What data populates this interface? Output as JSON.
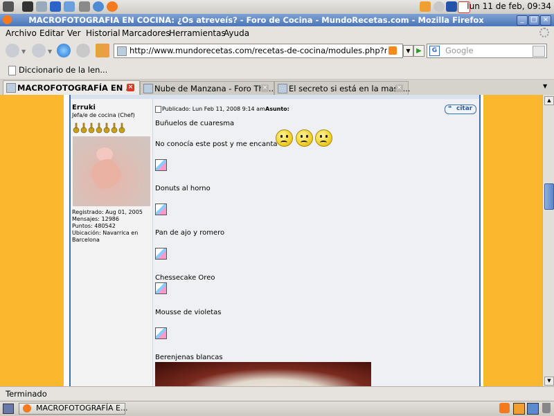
{
  "top_panel": {
    "clock": "lun 11 de feb, 09:34"
  },
  "window": {
    "title": "MACROFOTOGRAFIA EN COCINA: ¿Os atreveís? - Foro de Cocina - MundoRecetas.com - Mozilla Firefox"
  },
  "menu": {
    "archivo": "Archivo",
    "editar": "Editar",
    "ver": "Ver",
    "historial": "Historial",
    "marcadores": "Marcadores",
    "herramientas": "Herramientas",
    "ayuda": "Ayuda"
  },
  "navbar": {
    "url": "http://www.mundorecetas.com/recetas-de-cocina/modules.php?name=Foro",
    "search_placeholder": "Google"
  },
  "bookmarks": {
    "item1": "Diccionario de la len..."
  },
  "tabs": [
    {
      "label": "MACROFOTOGRAFÍA EN ..."
    },
    {
      "label": "Nube de Manzana - Foro The..."
    },
    {
      "label": "El secreto si está en la masa..."
    }
  ],
  "post": {
    "author": "Erruki",
    "rank": "Jefa/e de cocina (Chef)",
    "registered": "Registrado: Aug 01, 2005",
    "messages": "Mensajes: 12986",
    "points": "Puntos: 480542",
    "location": "Ubicación: Navarrica en Barcelona",
    "published": "Publicado: Lun Feb 11, 2008 9:14 am",
    "subject": "Asunto:",
    "quote_button": "citar",
    "lines": [
      "Buñuelos de cuaresma",
      "No conocía este post y me encanta",
      "Donuts al horno",
      "Pan de ajo y romero",
      "Chessecake Oreo",
      "Mousse de violetas",
      "Berenjenas blancas"
    ]
  },
  "status": {
    "text": "Terminado"
  },
  "taskbar": {
    "window_button": "MACROFOTOGRAFÍA E..."
  }
}
